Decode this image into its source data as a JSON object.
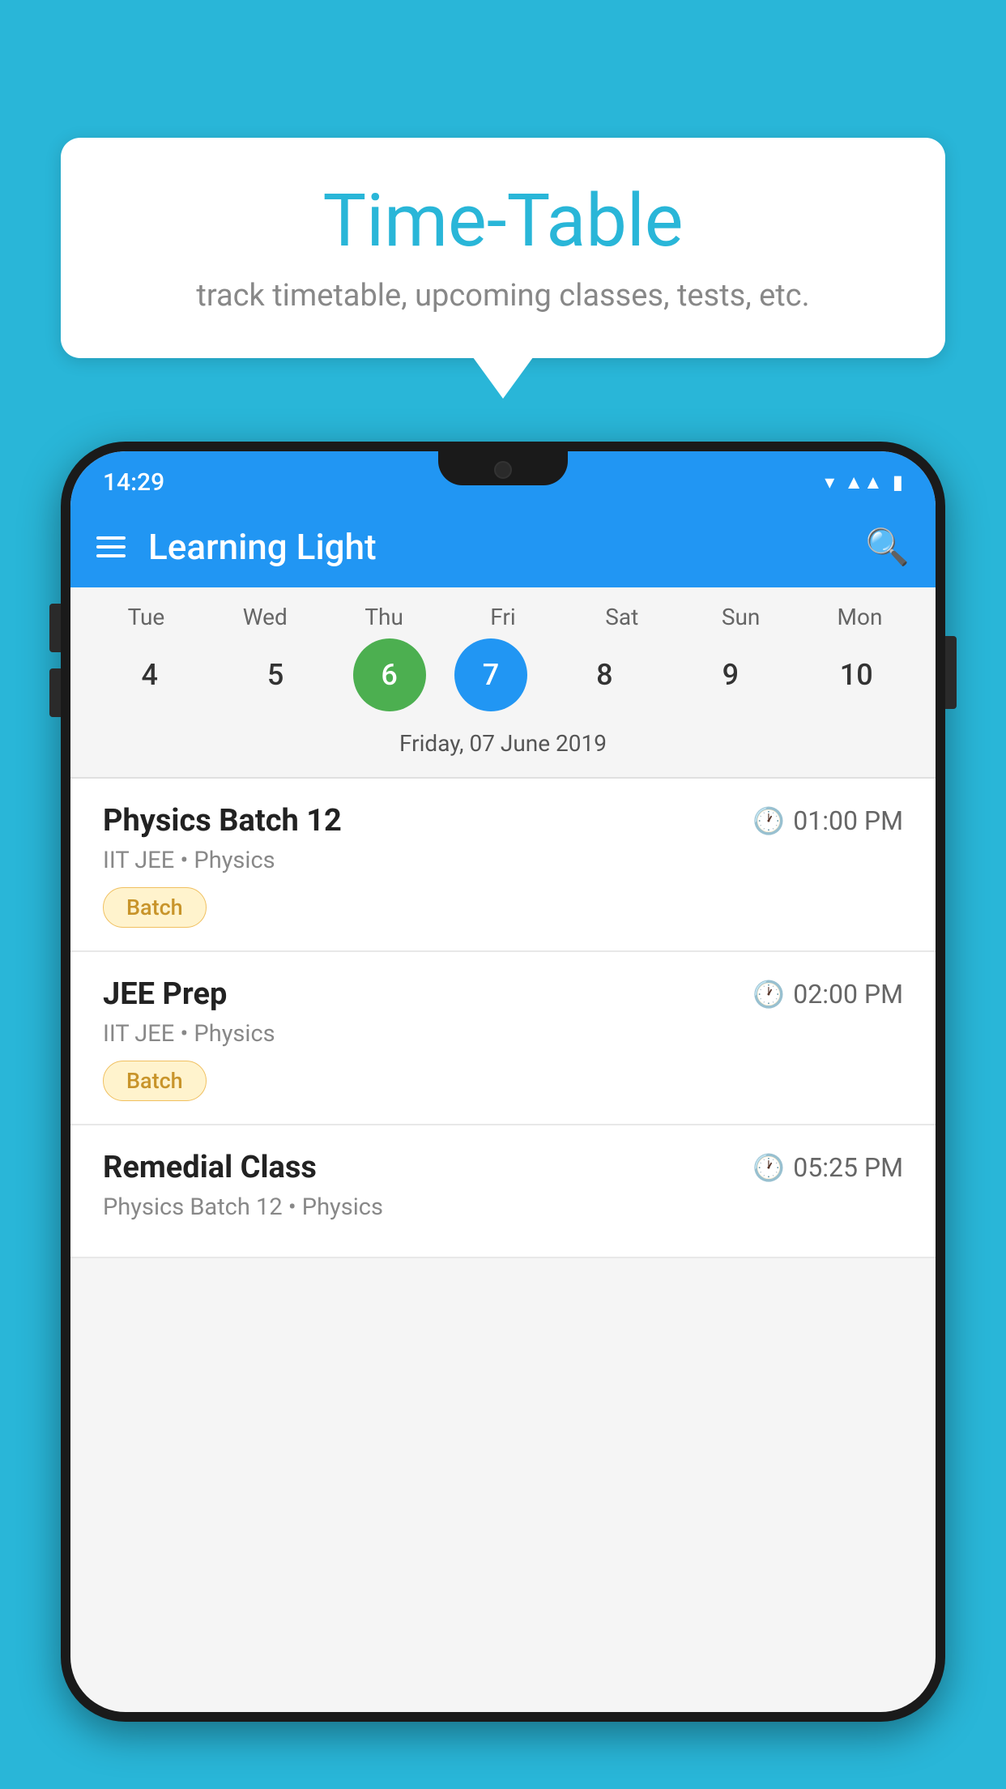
{
  "bubble": {
    "title": "Time-Table",
    "subtitle": "track timetable, upcoming classes, tests, etc."
  },
  "app": {
    "name": "Learning Light",
    "status_time": "14:29"
  },
  "calendar": {
    "days": [
      {
        "label": "Tue",
        "num": "4"
      },
      {
        "label": "Wed",
        "num": "5"
      },
      {
        "label": "Thu",
        "num": "6",
        "state": "today"
      },
      {
        "label": "Fri",
        "num": "7",
        "state": "selected"
      },
      {
        "label": "Sat",
        "num": "8"
      },
      {
        "label": "Sun",
        "num": "9"
      },
      {
        "label": "Mon",
        "num": "10"
      }
    ],
    "selected_date": "Friday, 07 June 2019"
  },
  "schedule": [
    {
      "title": "Physics Batch 12",
      "time": "01:00 PM",
      "meta": "IIT JEE • Physics",
      "badge": "Batch"
    },
    {
      "title": "JEE Prep",
      "time": "02:00 PM",
      "meta": "IIT JEE • Physics",
      "badge": "Batch"
    },
    {
      "title": "Remedial Class",
      "time": "05:25 PM",
      "meta": "Physics Batch 12 • Physics",
      "badge": ""
    }
  ]
}
